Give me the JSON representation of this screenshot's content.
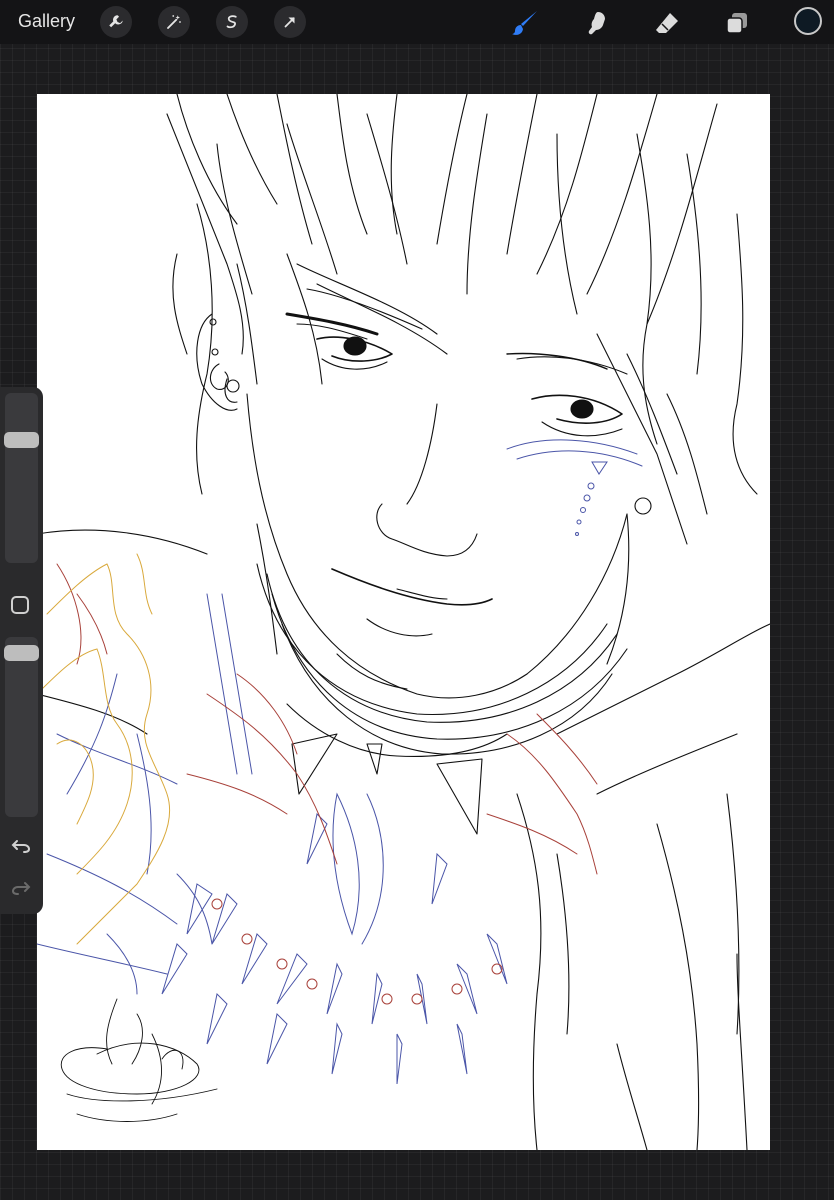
{
  "topbar": {
    "gallery_label": "Gallery",
    "tools_left": [
      "wrench-icon",
      "magic-wand-icon",
      "selection-icon",
      "transform-arrow-icon"
    ],
    "tools_right": [
      "brush-icon",
      "smudge-icon",
      "eraser-icon",
      "layers-icon"
    ],
    "active_tool": "brush-icon",
    "active_color": "#0e1a24",
    "accent_color": "#2f7cf6"
  },
  "canvas": {
    "line_colors": {
      "ink": "#111111",
      "blue": "#4a55a8",
      "red": "#a8413a",
      "gold": "#d9a93c"
    }
  },
  "sidebar": {
    "brush_size_level": 0.75,
    "opacity_level": 0.95,
    "icons": [
      "modify-square-icon",
      "undo-icon",
      "redo-icon"
    ]
  }
}
